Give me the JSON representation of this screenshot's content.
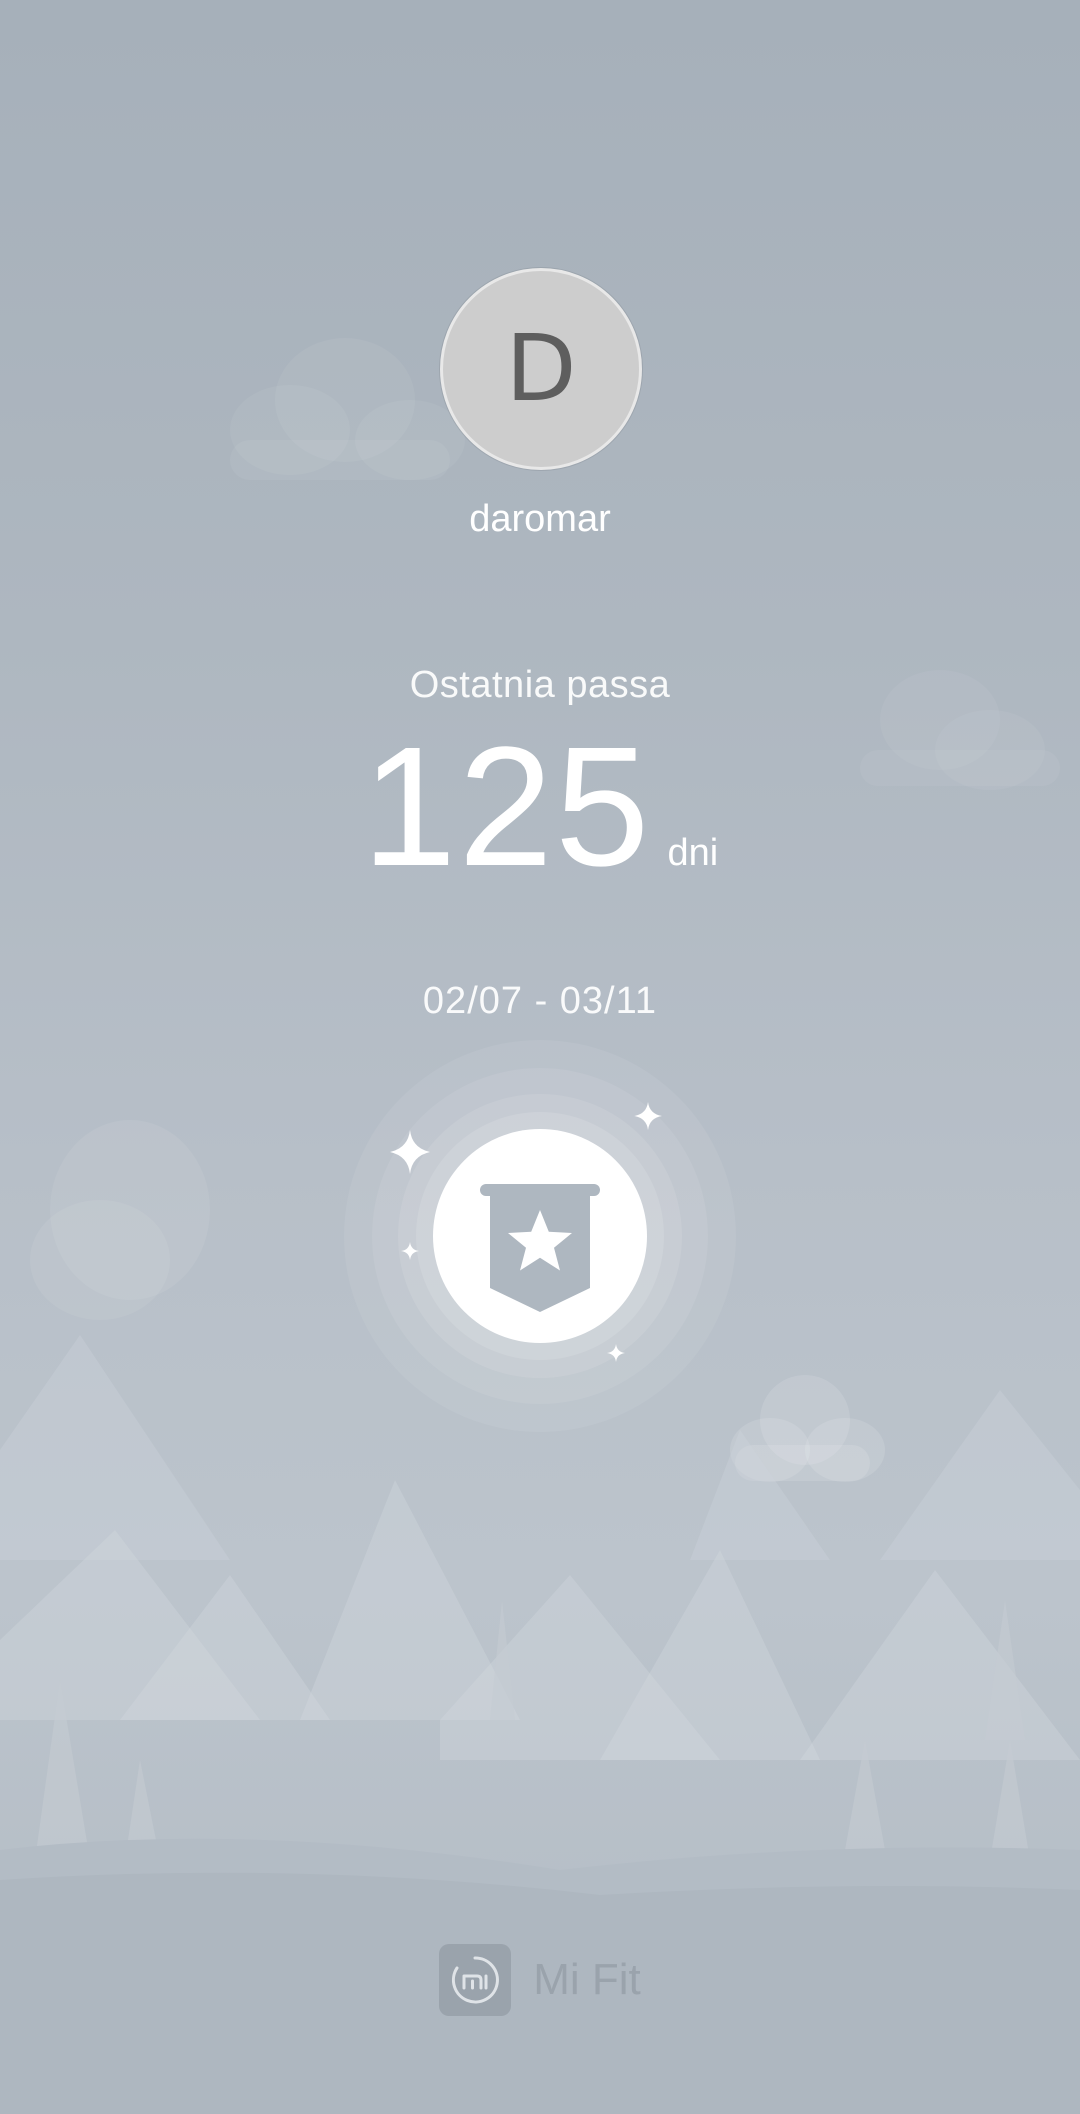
{
  "profile": {
    "avatar_letter": "D",
    "username": "daromar"
  },
  "streak": {
    "label": "Ostatnia passa",
    "value": "125",
    "unit": "dni",
    "date_range": "02/07 - 03/11"
  },
  "badge": {
    "icon": "star-banner-icon"
  },
  "footer": {
    "app_name": "Mi Fit",
    "app_icon": "mi-logo-icon"
  },
  "colors": {
    "background": "#aeb7c0",
    "text": "#ffffff",
    "logo": "#9aa3ac"
  }
}
